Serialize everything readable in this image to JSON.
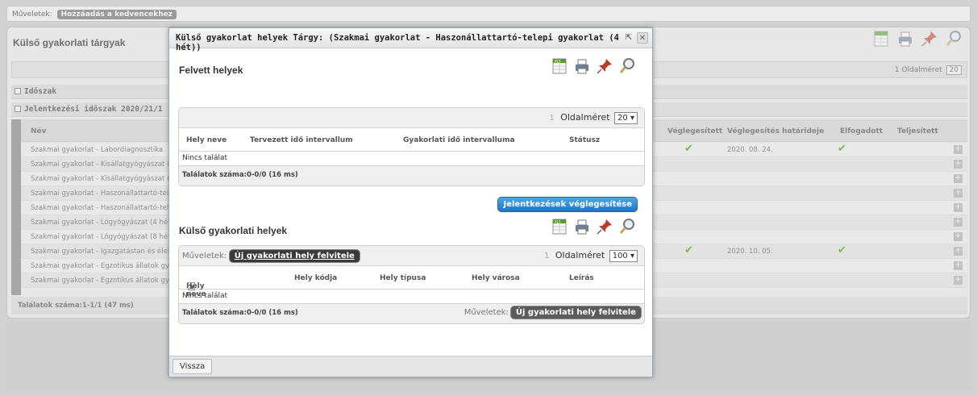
{
  "bg": {
    "ops_label": "Műveletek:",
    "fav_button": "Hozzáadás a kedvencekhez",
    "title": "Külső gyakorlati tárgyak",
    "page_size_label": "Oldalméret",
    "page_size_value": "20",
    "page_num": "1",
    "group1": "Időszak",
    "group2": "Jelentkezési időszak 2020/21/1",
    "columns": {
      "nev": "Név",
      "veglegesitett": "Véglegesített",
      "hatarido": "Véglegesítés határideje",
      "elfogadott": "Elfogadott",
      "teljesitett": "Teljesített"
    },
    "rows": [
      {
        "name": "Szakmai gyakorlat - Labordiagnosztika",
        "final": "✔",
        "date": "2020. 08. 24.",
        "accepted": "✔"
      },
      {
        "name": "Szakmai gyakorlat - Kisállatgyógyászat (",
        "final": "",
        "date": "",
        "accepted": ""
      },
      {
        "name": "Szakmai gyakorlat - Kisállatgyógyászat (",
        "final": "",
        "date": "",
        "accepted": ""
      },
      {
        "name": "Szakmai gyakorlat - Haszonállattartó-tele",
        "final": "",
        "date": "",
        "accepted": ""
      },
      {
        "name": "Szakmai gyakorlat - Haszonállattartó-tele",
        "final": "",
        "date": "",
        "accepted": ""
      },
      {
        "name": "Szakmai gyakorlat - Lógyógyászat (4 hét",
        "final": "",
        "date": "",
        "accepted": ""
      },
      {
        "name": "Szakmai gyakorlat - Lógyógyászat (8 hét",
        "final": "",
        "date": "",
        "accepted": ""
      },
      {
        "name": "Szakmai gyakorlat - Igazgatástan és élel",
        "final": "✔",
        "date": "2020. 10. 05.",
        "accepted": "✔"
      },
      {
        "name": "Szakmai gyakorlat - Egzotikus állatok gy",
        "final": "",
        "date": "",
        "accepted": ""
      },
      {
        "name": "Szakmai gyakorlat - Egzotikus állatok gy",
        "final": "",
        "date": "",
        "accepted": ""
      }
    ],
    "plus": "+",
    "footer": "Találatok száma:1-1/1 (47 ms)"
  },
  "modal": {
    "title": "Külső gyakorlat helyek Tárgy: (Szakmai gyakorlat - Haszonállattartó-telepi gyakorlat (4 hét))",
    "popout_icon": "⇱",
    "close_icon": "✕",
    "section1": {
      "title": "Felvett helyek",
      "page_num": "1",
      "page_size_label": "Oldalméret",
      "page_size_value": "20 ▾",
      "col_hely": "Hely neve",
      "col_tervezett": "Tervezett idő intervallum",
      "col_gyakorlati": "Gyakorlati idő intervalluma",
      "col_statusz": "Státusz",
      "empty": "Nincs találat",
      "count": "Találatok száma:0-0/0 (16 ms)"
    },
    "finalize_button": "Jelentkezések véglegesítése",
    "section2": {
      "title": "Külső gyakorlati helyek",
      "ops_label": "Műveletek:",
      "add_button": "Új gyakorlati hely felvitele",
      "page_num": "1",
      "page_size_label": "Oldalméret",
      "page_size_value": "100 ▾",
      "col_hely": "Hely neve",
      "sort_icon": "▲",
      "col_kod": "Hely kódja",
      "col_tipus": "Hely típusa",
      "col_varos": "Hely városa",
      "col_leiras": "Leírás",
      "empty": "Nincs találat",
      "count": "Találatok száma:0-0/0 (16 ms)",
      "footer_ops_label": "Műveletek:",
      "footer_add_button": "Új gyakorlati hely felvitele"
    },
    "back_button": "Vissza"
  },
  "icons": [
    "excel-icon",
    "print-icon",
    "pin-icon",
    "search-icon"
  ],
  "colors": {
    "accent_blue": "#1e75c6",
    "check_green": "#7ab850",
    "pin_red": "#c0392b"
  }
}
